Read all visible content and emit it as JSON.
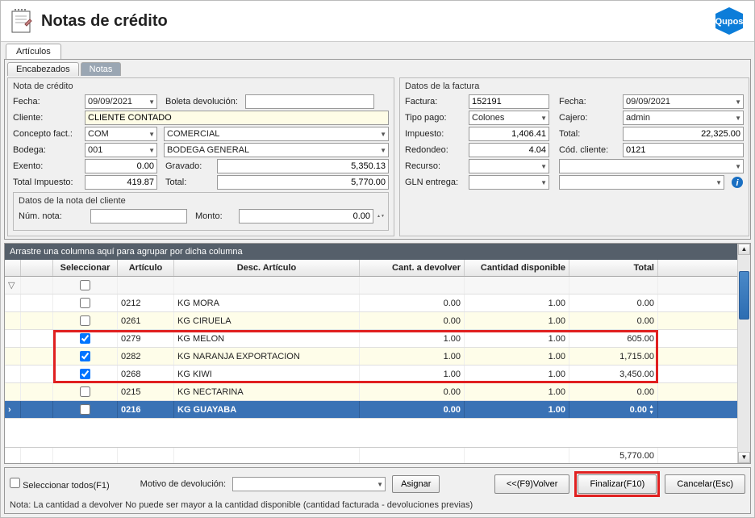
{
  "header": {
    "title": "Notas de crédito"
  },
  "articulos_tab": "Artículos",
  "innerTabs": {
    "a": "Encabezados",
    "b": "Notas"
  },
  "nota": {
    "legend": "Nota de crédito",
    "fecha_l": "Fecha:",
    "fecha_v": "09/09/2021",
    "boleta_l": "Boleta devolución:",
    "boleta_v": "",
    "cliente_l": "Cliente:",
    "cliente_v": "CLIENTE CONTADO",
    "concepto_l": "Concepto fact.:",
    "concepto_code": "COM",
    "concepto_desc": "COMERCIAL",
    "bodega_l": "Bodega:",
    "bodega_code": "001",
    "bodega_desc": "BODEGA GENERAL",
    "exento_l": "Exento:",
    "exento_v": "0.00",
    "gravado_l": "Gravado:",
    "gravado_v": "5,350.13",
    "timp_l": "Total Impuesto:",
    "timp_v": "419.87",
    "total_l": "Total:",
    "total_v": "5,770.00",
    "sub_legend": "Datos de la nota del cliente",
    "numnota_l": "Núm. nota:",
    "numnota_v": "",
    "monto_l": "Monto:",
    "monto_v": "0.00"
  },
  "fact": {
    "legend": "Datos de la factura",
    "factura_l": "Factura:",
    "factura_v": "152191",
    "fecha_l": "Fecha:",
    "fecha_v": "09/09/2021",
    "tipo_l": "Tipo pago:",
    "tipo_v": "Colones",
    "cajero_l": "Cajero:",
    "cajero_v": "admin",
    "imp_l": "Impuesto:",
    "imp_v": "1,406.41",
    "total_l": "Total:",
    "total_v": "22,325.00",
    "red_l": "Redondeo:",
    "red_v": "4.04",
    "cod_l": "Cód. cliente:",
    "cod_v": "0121",
    "rec_l": "Recurso:",
    "rec_v": "",
    "gln_l": "GLN entrega:",
    "gln_v": ""
  },
  "grid": {
    "groupbar": "Arrastre una columna aquí para agrupar por dicha columna",
    "cols": {
      "sel": "Seleccionar",
      "art": "Artículo",
      "desc": "Desc. Artículo",
      "cant": "Cant. a devolver",
      "disp": "Cantidad disponible",
      "tot": "Total"
    },
    "rows": [
      {
        "sel": false,
        "art": "0212",
        "desc": "KG MORA",
        "cant": "0.00",
        "disp": "1.00",
        "tot": "0.00"
      },
      {
        "sel": false,
        "art": "0261",
        "desc": "KG CIRUELA",
        "cant": "0.00",
        "disp": "1.00",
        "tot": "0.00"
      },
      {
        "sel": true,
        "art": "0279",
        "desc": "KG MELON",
        "cant": "1.00",
        "disp": "1.00",
        "tot": "605.00"
      },
      {
        "sel": true,
        "art": "0282",
        "desc": "KG NARANJA EXPORTACION",
        "cant": "1.00",
        "disp": "1.00",
        "tot": "1,715.00"
      },
      {
        "sel": true,
        "art": "0268",
        "desc": "KG KIWI",
        "cant": "1.00",
        "disp": "1.00",
        "tot": "3,450.00"
      },
      {
        "sel": false,
        "art": "0215",
        "desc": "KG NECTARINA",
        "cant": "0.00",
        "disp": "1.00",
        "tot": "0.00"
      },
      {
        "sel": false,
        "art": "0216",
        "desc": "KG GUAYABA",
        "cant": "0.00",
        "disp": "1.00",
        "tot": "0.00"
      }
    ],
    "sum_total": "5,770.00"
  },
  "footer": {
    "selall": "Seleccionar todos(F1)",
    "motivo_l": "Motivo de devolución:",
    "asignar": "Asignar",
    "volver": "<<(F9)Volver",
    "finalizar": "Finalizar(F10)",
    "cancelar": "Cancelar(Esc)",
    "note": "Nota: La cantidad a devolver No puede ser mayor a la cantidad disponible (cantidad facturada - devoluciones previas)"
  }
}
